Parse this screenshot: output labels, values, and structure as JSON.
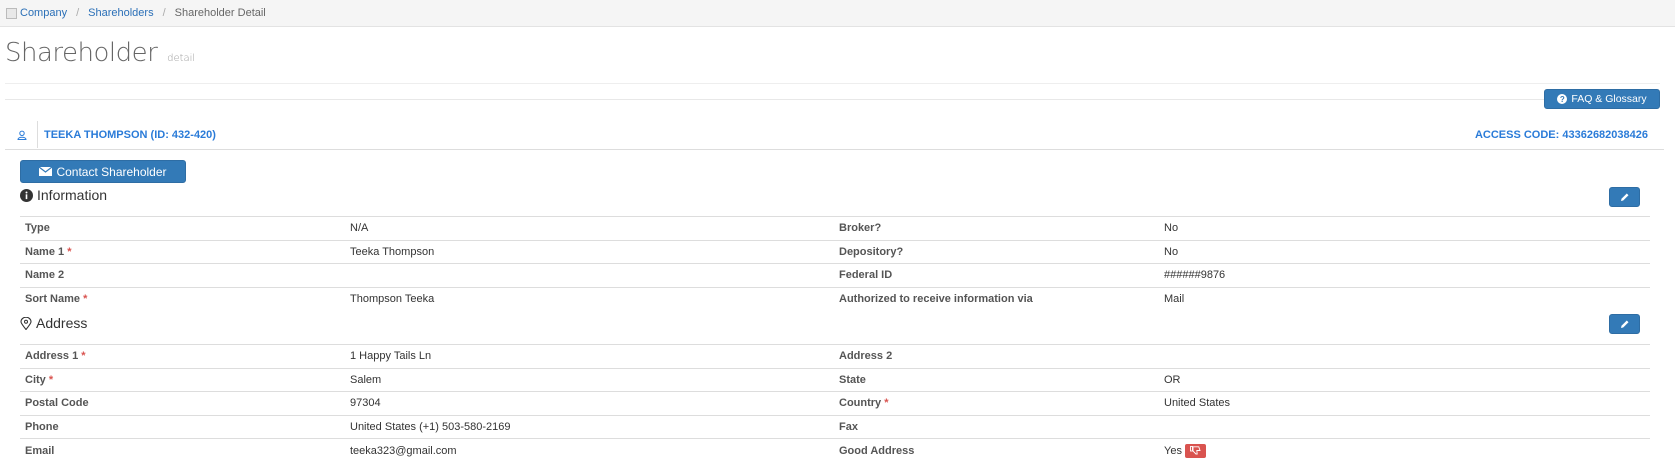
{
  "breadcrumb": {
    "items": [
      "Company",
      "Shareholders"
    ],
    "current": "Shareholder Detail"
  },
  "page": {
    "title": "Shareholder",
    "subtitle": "detail"
  },
  "faq_button": "FAQ & Glossary",
  "shareholder": {
    "name": "TEEKA THOMPSON (ID: 432-420)",
    "access_code": "ACCESS CODE: 43362682038426"
  },
  "contact_button": "Contact Shareholder",
  "information": {
    "title": "Information",
    "rows": [
      {
        "label1": "Type",
        "req1": "",
        "value1": "N/A",
        "label2": "Broker?",
        "req2": "",
        "value2": "No"
      },
      {
        "label1": "Name 1",
        "req1": "*",
        "value1": "Teeka Thompson",
        "label2": "Depository?",
        "req2": "",
        "value2": "No"
      },
      {
        "label1": "Name 2",
        "req1": "",
        "value1": "",
        "label2": "Federal ID",
        "req2": "",
        "value2": "######9876"
      },
      {
        "label1": "Sort Name",
        "req1": "*",
        "value1": "Thompson Teeka",
        "label2": "Authorized to receive information via",
        "req2": "",
        "value2": "Mail"
      }
    ]
  },
  "address": {
    "title": "Address",
    "rows": [
      {
        "label1": "Address 1",
        "req1": "*",
        "value1": "1 Happy Tails Ln",
        "label2": "Address 2",
        "req2": "",
        "value2": ""
      },
      {
        "label1": "City",
        "req1": "*",
        "value1": "Salem",
        "label2": "State",
        "req2": "",
        "value2": "OR"
      },
      {
        "label1": "Postal Code",
        "req1": "",
        "value1": "97304",
        "label2": "Country",
        "req2": "*",
        "value2": "United States"
      },
      {
        "label1": "Phone",
        "req1": "",
        "value1": "United States (+1) 503-580-2169",
        "label2": "Fax",
        "req2": "",
        "value2": ""
      },
      {
        "label1": "Email",
        "req1": "",
        "value1": "teeka323@gmail.com",
        "label2": "Good Address",
        "req2": "",
        "value2": "Yes"
      }
    ]
  },
  "icons": {
    "home": "home-icon",
    "help": "question-circle-icon",
    "user": "user-icon",
    "envelope": "envelope-icon",
    "info": "info-circle-icon",
    "map_marker": "map-marker-icon",
    "pencil": "pencil-icon",
    "thumbs_down": "thumbs-down-icon"
  },
  "colors": {
    "primary": "#337ab7",
    "link": "#2a7bd8",
    "danger": "#d9534f"
  }
}
